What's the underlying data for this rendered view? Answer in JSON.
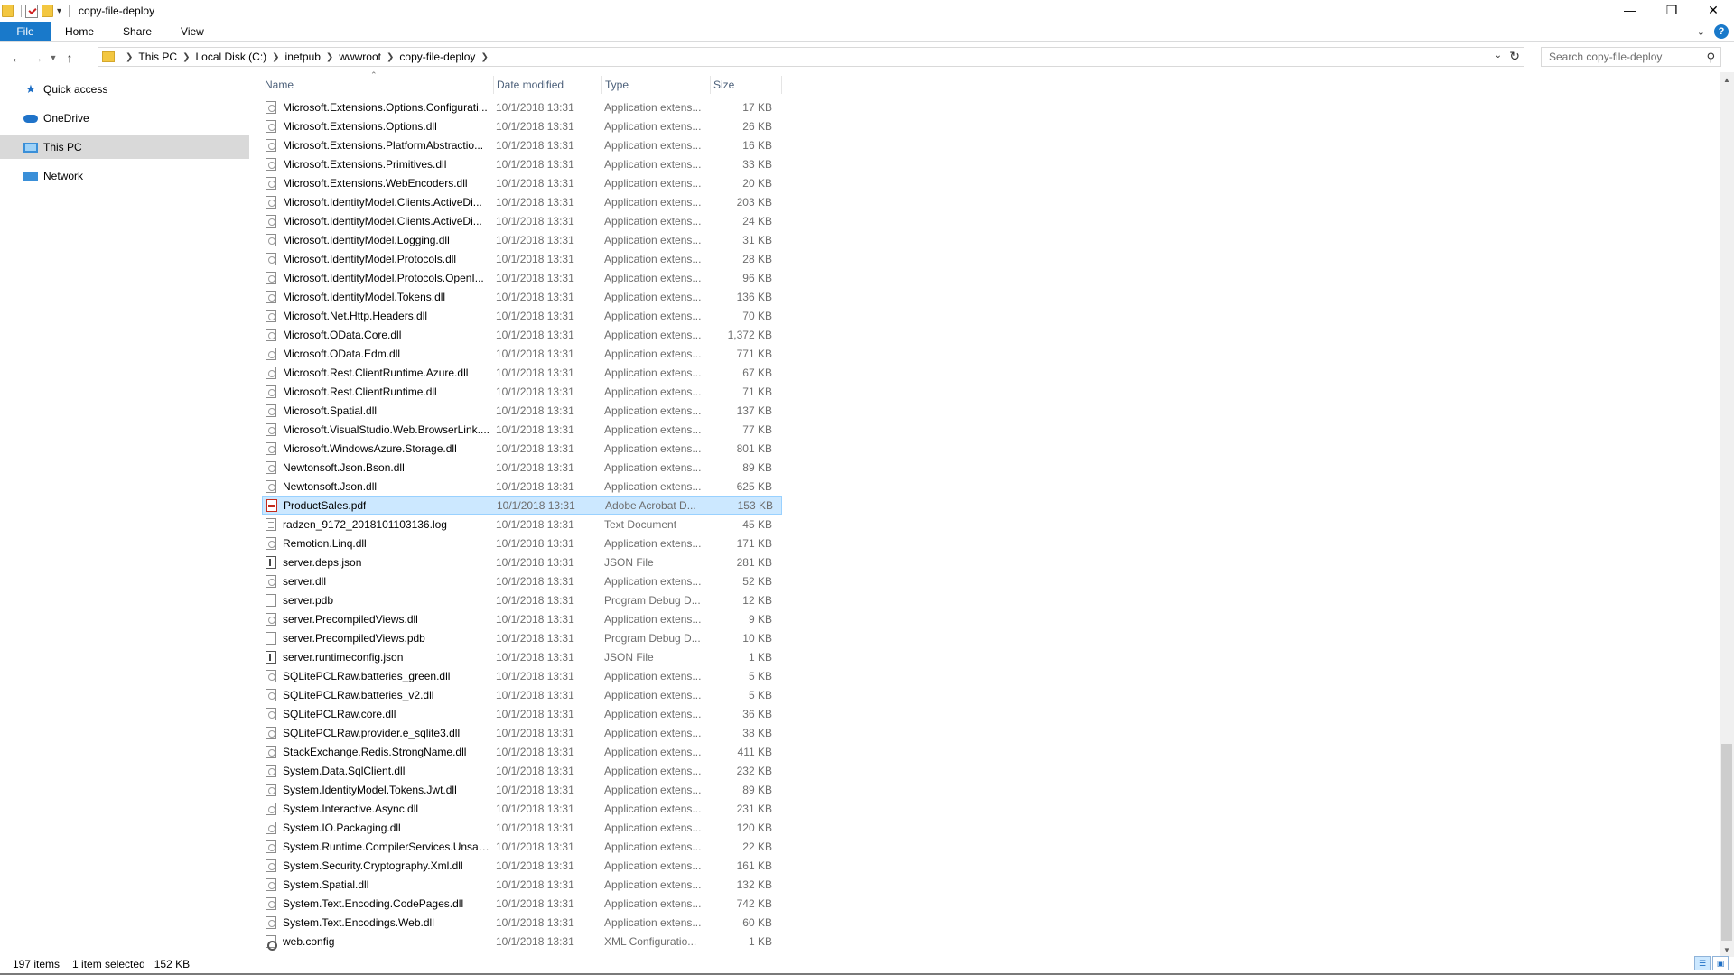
{
  "window": {
    "title": "copy-file-deploy"
  },
  "ribbon": {
    "tabs": [
      "File",
      "Home",
      "Share",
      "View"
    ],
    "help": "?"
  },
  "address": {
    "breadcrumbs": [
      "This PC",
      "Local Disk (C:)",
      "inetpub",
      "wwwroot",
      "copy-file-deploy"
    ]
  },
  "search": {
    "placeholder": "Search copy-file-deploy"
  },
  "nav": {
    "items": [
      "Quick access",
      "OneDrive",
      "This PC",
      "Network"
    ],
    "selected": "This PC"
  },
  "columns": {
    "name": "Name",
    "date": "Date modified",
    "type": "Type",
    "size": "Size"
  },
  "files": [
    {
      "name": "Microsoft.Extensions.Options.Configurati...",
      "date": "10/1/2018 13:31",
      "type": "Application extens...",
      "size": "17 KB",
      "icon": "dll"
    },
    {
      "name": "Microsoft.Extensions.Options.dll",
      "date": "10/1/2018 13:31",
      "type": "Application extens...",
      "size": "26 KB",
      "icon": "dll"
    },
    {
      "name": "Microsoft.Extensions.PlatformAbstractio...",
      "date": "10/1/2018 13:31",
      "type": "Application extens...",
      "size": "16 KB",
      "icon": "dll"
    },
    {
      "name": "Microsoft.Extensions.Primitives.dll",
      "date": "10/1/2018 13:31",
      "type": "Application extens...",
      "size": "33 KB",
      "icon": "dll"
    },
    {
      "name": "Microsoft.Extensions.WebEncoders.dll",
      "date": "10/1/2018 13:31",
      "type": "Application extens...",
      "size": "20 KB",
      "icon": "dll"
    },
    {
      "name": "Microsoft.IdentityModel.Clients.ActiveDi...",
      "date": "10/1/2018 13:31",
      "type": "Application extens...",
      "size": "203 KB",
      "icon": "dll"
    },
    {
      "name": "Microsoft.IdentityModel.Clients.ActiveDi...",
      "date": "10/1/2018 13:31",
      "type": "Application extens...",
      "size": "24 KB",
      "icon": "dll"
    },
    {
      "name": "Microsoft.IdentityModel.Logging.dll",
      "date": "10/1/2018 13:31",
      "type": "Application extens...",
      "size": "31 KB",
      "icon": "dll"
    },
    {
      "name": "Microsoft.IdentityModel.Protocols.dll",
      "date": "10/1/2018 13:31",
      "type": "Application extens...",
      "size": "28 KB",
      "icon": "dll"
    },
    {
      "name": "Microsoft.IdentityModel.Protocols.OpenI...",
      "date": "10/1/2018 13:31",
      "type": "Application extens...",
      "size": "96 KB",
      "icon": "dll"
    },
    {
      "name": "Microsoft.IdentityModel.Tokens.dll",
      "date": "10/1/2018 13:31",
      "type": "Application extens...",
      "size": "136 KB",
      "icon": "dll"
    },
    {
      "name": "Microsoft.Net.Http.Headers.dll",
      "date": "10/1/2018 13:31",
      "type": "Application extens...",
      "size": "70 KB",
      "icon": "dll"
    },
    {
      "name": "Microsoft.OData.Core.dll",
      "date": "10/1/2018 13:31",
      "type": "Application extens...",
      "size": "1,372 KB",
      "icon": "dll"
    },
    {
      "name": "Microsoft.OData.Edm.dll",
      "date": "10/1/2018 13:31",
      "type": "Application extens...",
      "size": "771 KB",
      "icon": "dll"
    },
    {
      "name": "Microsoft.Rest.ClientRuntime.Azure.dll",
      "date": "10/1/2018 13:31",
      "type": "Application extens...",
      "size": "67 KB",
      "icon": "dll"
    },
    {
      "name": "Microsoft.Rest.ClientRuntime.dll",
      "date": "10/1/2018 13:31",
      "type": "Application extens...",
      "size": "71 KB",
      "icon": "dll"
    },
    {
      "name": "Microsoft.Spatial.dll",
      "date": "10/1/2018 13:31",
      "type": "Application extens...",
      "size": "137 KB",
      "icon": "dll"
    },
    {
      "name": "Microsoft.VisualStudio.Web.BrowserLink....",
      "date": "10/1/2018 13:31",
      "type": "Application extens...",
      "size": "77 KB",
      "icon": "dll"
    },
    {
      "name": "Microsoft.WindowsAzure.Storage.dll",
      "date": "10/1/2018 13:31",
      "type": "Application extens...",
      "size": "801 KB",
      "icon": "dll"
    },
    {
      "name": "Newtonsoft.Json.Bson.dll",
      "date": "10/1/2018 13:31",
      "type": "Application extens...",
      "size": "89 KB",
      "icon": "dll"
    },
    {
      "name": "Newtonsoft.Json.dll",
      "date": "10/1/2018 13:31",
      "type": "Application extens...",
      "size": "625 KB",
      "icon": "dll"
    },
    {
      "name": "ProductSales.pdf",
      "date": "10/1/2018 13:31",
      "type": "Adobe Acrobat D...",
      "size": "153 KB",
      "icon": "pdf",
      "selected": true
    },
    {
      "name": "radzen_9172_2018101103136.log",
      "date": "10/1/2018 13:31",
      "type": "Text Document",
      "size": "45 KB",
      "icon": "log"
    },
    {
      "name": "Remotion.Linq.dll",
      "date": "10/1/2018 13:31",
      "type": "Application extens...",
      "size": "171 KB",
      "icon": "dll"
    },
    {
      "name": "server.deps.json",
      "date": "10/1/2018 13:31",
      "type": "JSON File",
      "size": "281 KB",
      "icon": "json"
    },
    {
      "name": "server.dll",
      "date": "10/1/2018 13:31",
      "type": "Application extens...",
      "size": "52 KB",
      "icon": "dll"
    },
    {
      "name": "server.pdb",
      "date": "10/1/2018 13:31",
      "type": "Program Debug D...",
      "size": "12 KB",
      "icon": "file"
    },
    {
      "name": "server.PrecompiledViews.dll",
      "date": "10/1/2018 13:31",
      "type": "Application extens...",
      "size": "9 KB",
      "icon": "dll"
    },
    {
      "name": "server.PrecompiledViews.pdb",
      "date": "10/1/2018 13:31",
      "type": "Program Debug D...",
      "size": "10 KB",
      "icon": "file"
    },
    {
      "name": "server.runtimeconfig.json",
      "date": "10/1/2018 13:31",
      "type": "JSON File",
      "size": "1 KB",
      "icon": "json"
    },
    {
      "name": "SQLitePCLRaw.batteries_green.dll",
      "date": "10/1/2018 13:31",
      "type": "Application extens...",
      "size": "5 KB",
      "icon": "dll"
    },
    {
      "name": "SQLitePCLRaw.batteries_v2.dll",
      "date": "10/1/2018 13:31",
      "type": "Application extens...",
      "size": "5 KB",
      "icon": "dll"
    },
    {
      "name": "SQLitePCLRaw.core.dll",
      "date": "10/1/2018 13:31",
      "type": "Application extens...",
      "size": "36 KB",
      "icon": "dll"
    },
    {
      "name": "SQLitePCLRaw.provider.e_sqlite3.dll",
      "date": "10/1/2018 13:31",
      "type": "Application extens...",
      "size": "38 KB",
      "icon": "dll"
    },
    {
      "name": "StackExchange.Redis.StrongName.dll",
      "date": "10/1/2018 13:31",
      "type": "Application extens...",
      "size": "411 KB",
      "icon": "dll"
    },
    {
      "name": "System.Data.SqlClient.dll",
      "date": "10/1/2018 13:31",
      "type": "Application extens...",
      "size": "232 KB",
      "icon": "dll"
    },
    {
      "name": "System.IdentityModel.Tokens.Jwt.dll",
      "date": "10/1/2018 13:31",
      "type": "Application extens...",
      "size": "89 KB",
      "icon": "dll"
    },
    {
      "name": "System.Interactive.Async.dll",
      "date": "10/1/2018 13:31",
      "type": "Application extens...",
      "size": "231 KB",
      "icon": "dll"
    },
    {
      "name": "System.IO.Packaging.dll",
      "date": "10/1/2018 13:31",
      "type": "Application extens...",
      "size": "120 KB",
      "icon": "dll"
    },
    {
      "name": "System.Runtime.CompilerServices.Unsaf...",
      "date": "10/1/2018 13:31",
      "type": "Application extens...",
      "size": "22 KB",
      "icon": "dll"
    },
    {
      "name": "System.Security.Cryptography.Xml.dll",
      "date": "10/1/2018 13:31",
      "type": "Application extens...",
      "size": "161 KB",
      "icon": "dll"
    },
    {
      "name": "System.Spatial.dll",
      "date": "10/1/2018 13:31",
      "type": "Application extens...",
      "size": "132 KB",
      "icon": "dll"
    },
    {
      "name": "System.Text.Encoding.CodePages.dll",
      "date": "10/1/2018 13:31",
      "type": "Application extens...",
      "size": "742 KB",
      "icon": "dll"
    },
    {
      "name": "System.Text.Encodings.Web.dll",
      "date": "10/1/2018 13:31",
      "type": "Application extens...",
      "size": "60 KB",
      "icon": "dll"
    },
    {
      "name": "web.config",
      "date": "10/1/2018 13:31",
      "type": "XML Configuratio...",
      "size": "1 KB",
      "icon": "config"
    }
  ],
  "status": {
    "count": "197 items",
    "selection": "1 item selected",
    "size": "152 KB"
  },
  "colors": {
    "accent": "#1979ca",
    "selection": "#cce8ff",
    "selection_border": "#99d1ff",
    "nav_selected": "#d9d9d9"
  }
}
